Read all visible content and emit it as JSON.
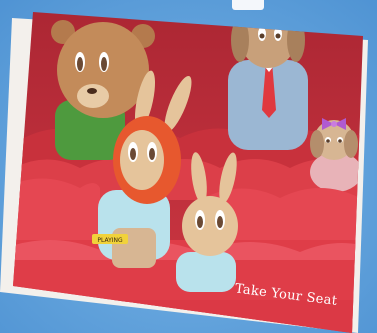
{
  "card": {
    "title": "Take Your Seat",
    "badge_text": "PLAYING"
  },
  "colors": {
    "background": "#5ea1dc",
    "card_border": "#f3f0ec",
    "theater_red": "#d8353f",
    "wall_red": "#c02a36",
    "seat_red": "#e24550"
  },
  "characters": [
    "bear",
    "dog-in-suit",
    "puppy-with-bow",
    "redhead-bunny",
    "small-bunny"
  ]
}
